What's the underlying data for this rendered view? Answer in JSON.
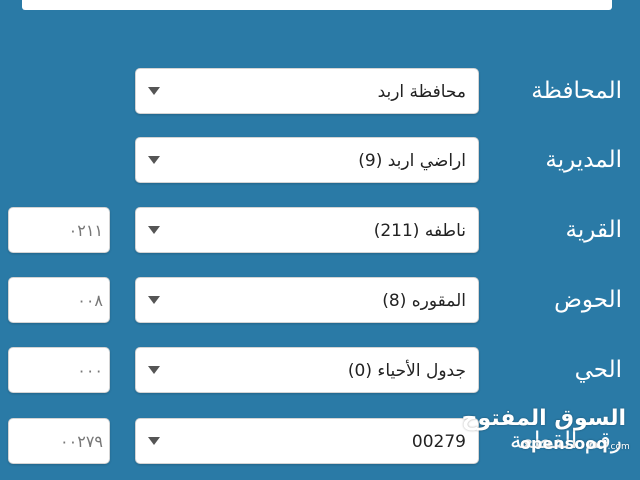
{
  "form": {
    "rows": [
      {
        "label": "المحافظة",
        "value": "محافظة اربد",
        "code": null
      },
      {
        "label": "المديرية",
        "value": "اراضي اربد (9)",
        "code": null
      },
      {
        "label": "القرية",
        "value": "ناطفه (211)",
        "code": "٠٢١١"
      },
      {
        "label": "الحوض",
        "value": "المقوره (8)",
        "code": "٠٠٨"
      },
      {
        "label": "الحي",
        "value": "جدول الأحياء (0)",
        "code": "٠٠٠"
      },
      {
        "label": "رقم القطعة",
        "value": "00279",
        "code": "٠٠٢٧٩"
      }
    ]
  },
  "watermark": {
    "arabic": "السوق المفتوح",
    "english": "opensooq",
    "suffix": ".com"
  },
  "colors": {
    "background": "#2a7aa6",
    "field": "#ffffff",
    "label": "#ffffff"
  }
}
